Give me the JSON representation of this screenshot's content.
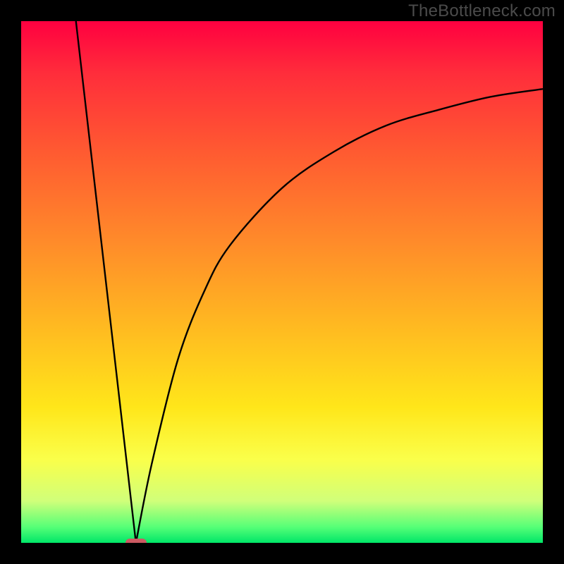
{
  "watermark": "TheBottleneck.com",
  "colors": {
    "background": "#000000",
    "watermark_text": "#4b4b4b",
    "curve": "#000000",
    "marker": "#cc5a62",
    "gradient_top": "#ff0040",
    "gradient_bottom": "#00e668"
  },
  "chart_data": {
    "type": "line",
    "title": "",
    "xlabel": "",
    "ylabel": "",
    "xlim": [
      0,
      100
    ],
    "ylim": [
      0,
      100
    ],
    "grid": false,
    "legend": false,
    "series": [
      {
        "name": "left-segment",
        "shape": "linear",
        "x": [
          10.5,
          22
        ],
        "y": [
          100,
          0
        ]
      },
      {
        "name": "right-segment",
        "shape": "concave-up-saturating",
        "x": [
          22,
          25,
          30,
          35,
          40,
          50,
          60,
          70,
          80,
          90,
          100
        ],
        "y": [
          0,
          15,
          35,
          48,
          57,
          68,
          75,
          80,
          83,
          85.5,
          87
        ]
      }
    ],
    "marker": {
      "x": 22,
      "y": 0,
      "label": ""
    },
    "background_gradient": {
      "direction": "vertical",
      "stops": [
        {
          "pos": 0,
          "color": "#ff0040"
        },
        {
          "pos": 10,
          "color": "#ff2d3b"
        },
        {
          "pos": 25,
          "color": "#ff5a31"
        },
        {
          "pos": 42,
          "color": "#ff8a2a"
        },
        {
          "pos": 58,
          "color": "#ffb821"
        },
        {
          "pos": 74,
          "color": "#ffe61a"
        },
        {
          "pos": 84,
          "color": "#faff4a"
        },
        {
          "pos": 92,
          "color": "#d0ff7a"
        },
        {
          "pos": 97,
          "color": "#55ff77"
        },
        {
          "pos": 100,
          "color": "#00e668"
        }
      ]
    }
  }
}
